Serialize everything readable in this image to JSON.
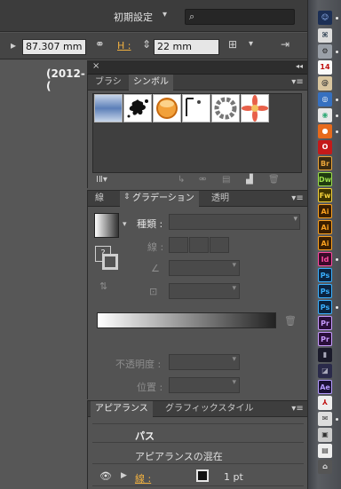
{
  "topbar": {
    "workspace": "初期設定",
    "workspace_arrow": "▾",
    "search_placeholder": ""
  },
  "ctrlbar": {
    "width_value": "87.307 mm",
    "height_label": "H :",
    "height_value": "22 mm"
  },
  "canvas": {
    "text1": "(2012-("
  },
  "brush_panel": {
    "tab1": "ブラシ",
    "tab2": "シンボル",
    "close": "×",
    "collapse": "◂◂"
  },
  "gradient_panel": {
    "tab1": "線",
    "tab2": "グラデーション",
    "tab3": "透明",
    "type_label": "種類 :",
    "stroke_label": "線 :",
    "opacity_label": "不透明度 :",
    "position_label": "位置 :",
    "question": "?"
  },
  "appearance_panel": {
    "tab1": "アピアランス",
    "tab2": "グラフィックスタイル",
    "row1": "パス",
    "row2": "アピアランスの混在",
    "stroke_label": "線 :",
    "stroke_value": "1 pt"
  },
  "dock": {
    "apps": [
      "",
      "",
      "",
      "14",
      "",
      "",
      "",
      "",
      "",
      "Br",
      "Dw",
      "Fw",
      "Ai",
      "Ai",
      "Ai",
      "Id",
      "Ps",
      "Ps",
      "Ps",
      "Pr",
      "Pr",
      "",
      "",
      "Ae",
      "",
      "",
      "",
      "",
      ""
    ]
  }
}
